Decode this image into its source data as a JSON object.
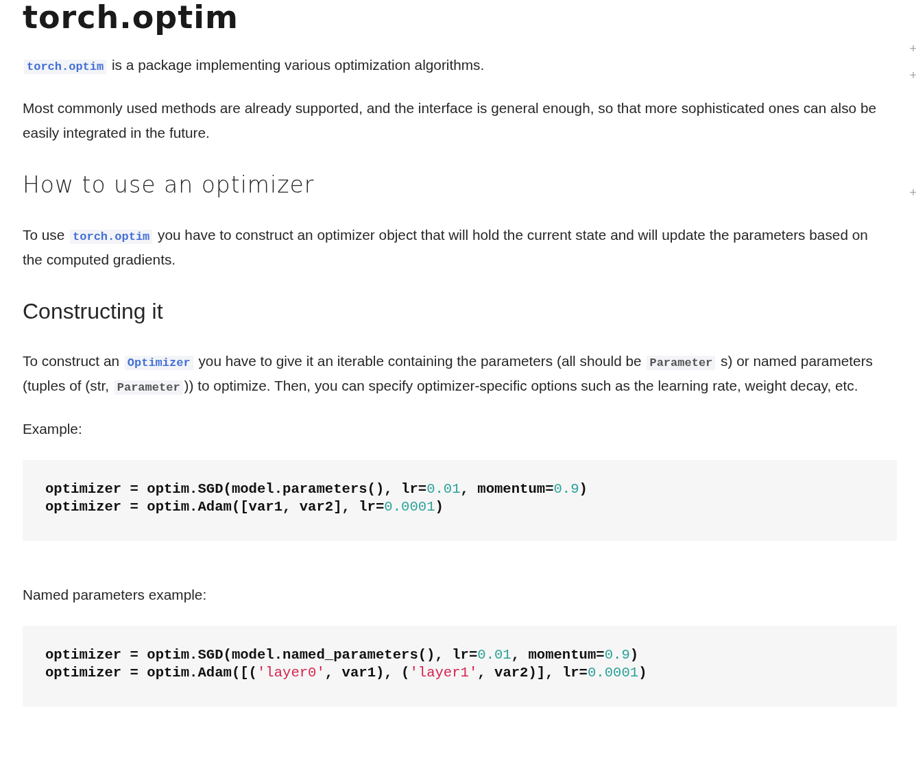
{
  "blocks": [
    {
      "kind": "h1",
      "text": "torch.optim"
    },
    {
      "kind": "p",
      "parts": [
        {
          "kind": "link",
          "text": "torch.optim"
        },
        {
          "kind": "text",
          "text": " is a package implementing various optimization algorithms."
        }
      ]
    },
    {
      "kind": "p",
      "parts": [
        {
          "kind": "text",
          "text": "Most commonly used methods are already supported, and the interface is general enough, so that more sophisticated ones can also be easily integrated in the future."
        }
      ]
    },
    {
      "kind": "h2",
      "text": "How to use an optimizer"
    },
    {
      "kind": "p",
      "parts": [
        {
          "kind": "text",
          "text": "To use "
        },
        {
          "kind": "link",
          "text": "torch.optim"
        },
        {
          "kind": "text",
          "text": " you have to construct an optimizer object that will hold the current state and will update the parameters based on the computed gradients."
        }
      ]
    },
    {
      "kind": "h3",
      "text": "Constructing it"
    },
    {
      "kind": "p",
      "parts": [
        {
          "kind": "text",
          "text": "To construct an "
        },
        {
          "kind": "link",
          "text": "Optimizer"
        },
        {
          "kind": "text",
          "text": " you have to give it an iterable containing the parameters (all should be "
        },
        {
          "kind": "code",
          "text": "Parameter"
        },
        {
          "kind": "text",
          "text": " s) or named parameters (tuples of (str, "
        },
        {
          "kind": "code",
          "text": "Parameter"
        },
        {
          "kind": "text",
          "text": ")) to optimize. Then, you can specify optimizer-specific options such as the learning rate, weight decay, etc."
        }
      ]
    },
    {
      "kind": "p",
      "parts": [
        {
          "kind": "text",
          "text": "Example:"
        }
      ]
    },
    {
      "kind": "code",
      "lines": [
        [
          {
            "kind": "plain",
            "text": "optimizer = optim.SGD(model.parameters(), lr="
          },
          {
            "kind": "number",
            "text": "0.01"
          },
          {
            "kind": "plain",
            "text": ", momentum="
          },
          {
            "kind": "number",
            "text": "0.9"
          },
          {
            "kind": "plain",
            "text": ")"
          }
        ],
        [
          {
            "kind": "plain",
            "text": "optimizer = optim.Adam([var1, var2], lr="
          },
          {
            "kind": "number",
            "text": "0.0001"
          },
          {
            "kind": "plain",
            "text": ")"
          }
        ]
      ]
    },
    {
      "kind": "p",
      "parts": [
        {
          "kind": "text",
          "text": "Named parameters example:"
        }
      ]
    },
    {
      "kind": "code",
      "lines": [
        [
          {
            "kind": "plain",
            "text": "optimizer = optim.SGD(model.named_parameters(), lr="
          },
          {
            "kind": "number",
            "text": "0.01"
          },
          {
            "kind": "plain",
            "text": ", momentum="
          },
          {
            "kind": "number",
            "text": "0.9"
          },
          {
            "kind": "plain",
            "text": ")"
          }
        ],
        [
          {
            "kind": "plain",
            "text": "optimizer = optim.Adam([("
          },
          {
            "kind": "string",
            "text": "'layer0'"
          },
          {
            "kind": "plain",
            "text": ", var1), ("
          },
          {
            "kind": "string",
            "text": "'layer1'"
          },
          {
            "kind": "plain",
            "text": ", var2)], lr="
          },
          {
            "kind": "number",
            "text": "0.0001"
          },
          {
            "kind": "plain",
            "text": ")"
          }
        ]
      ]
    }
  ]
}
